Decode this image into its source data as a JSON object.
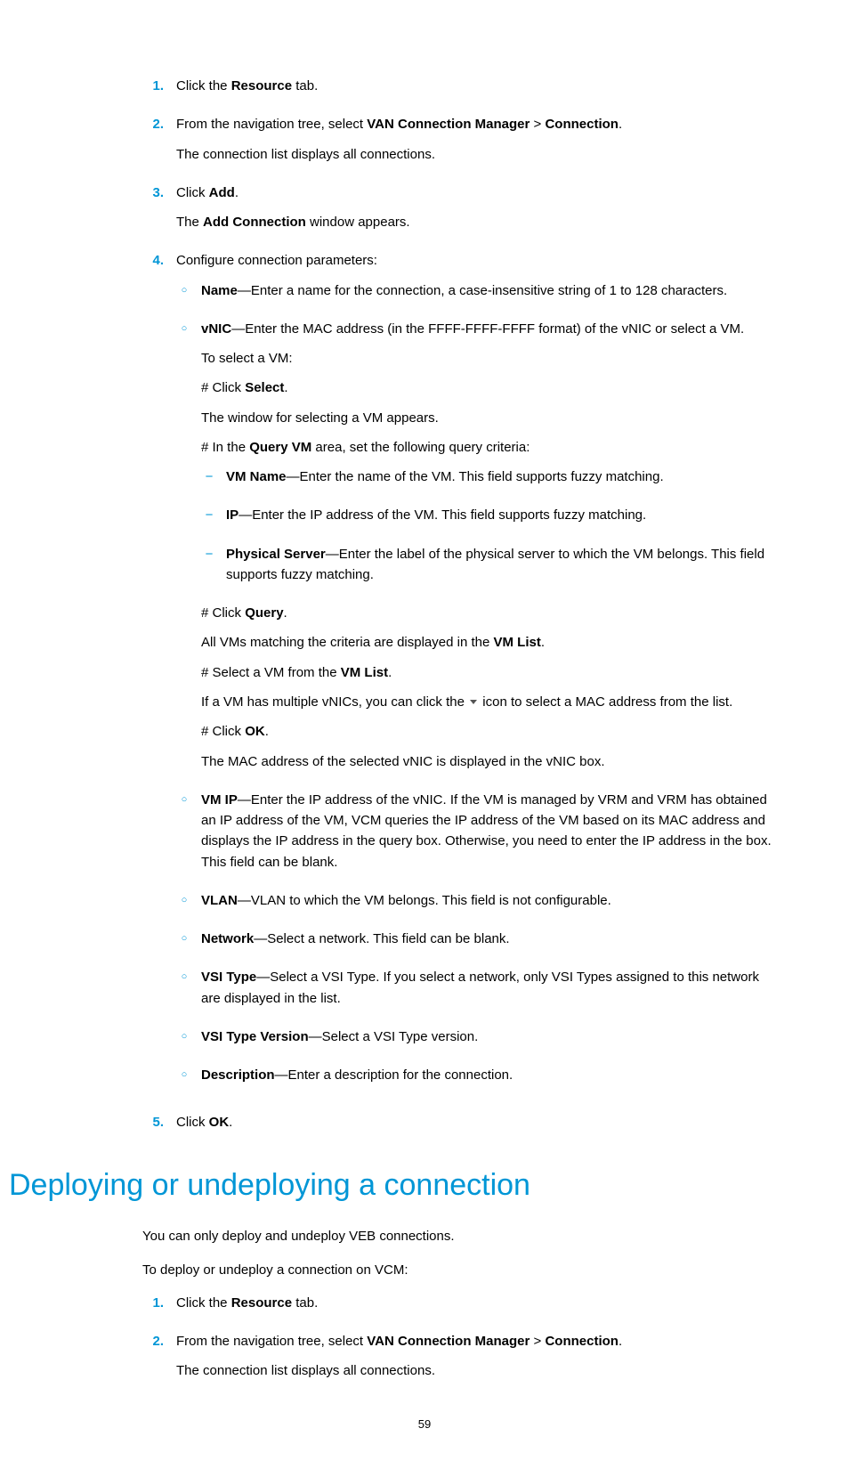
{
  "section1": {
    "steps": [
      {
        "num": "1.",
        "lines": [
          {
            "frags": [
              [
                "t",
                "Click the "
              ],
              [
                "b",
                "Resource"
              ],
              [
                "t",
                " tab."
              ]
            ]
          }
        ]
      },
      {
        "num": "2.",
        "lines": [
          {
            "frags": [
              [
                "t",
                "From the navigation tree, select "
              ],
              [
                "b",
                "VAN Connection Manager"
              ],
              [
                "t",
                " > "
              ],
              [
                "b",
                "Connection"
              ],
              [
                "t",
                "."
              ]
            ]
          },
          {
            "frags": [
              [
                "t",
                "The connection list displays all connections."
              ]
            ]
          }
        ]
      },
      {
        "num": "3.",
        "lines": [
          {
            "frags": [
              [
                "t",
                "Click "
              ],
              [
                "b",
                "Add"
              ],
              [
                "t",
                "."
              ]
            ]
          },
          {
            "frags": [
              [
                "t",
                "The "
              ],
              [
                "b",
                "Add Connection"
              ],
              [
                "t",
                " window appears."
              ]
            ]
          }
        ]
      },
      {
        "num": "4.",
        "lines": [
          {
            "frags": [
              [
                "t",
                "Configure connection parameters:"
              ]
            ]
          }
        ],
        "subs": [
          {
            "bullet": "o",
            "lines": [
              {
                "frags": [
                  [
                    "b",
                    "Name"
                  ],
                  [
                    "t",
                    "—Enter a name for the connection, a case-insensitive string of 1 to 128 characters."
                  ]
                ]
              }
            ]
          },
          {
            "bullet": "o",
            "lines": [
              {
                "frags": [
                  [
                    "b",
                    "vNIC"
                  ],
                  [
                    "t",
                    "—Enter the MAC address (in the FFFF-FFFF-FFFF format) of the vNIC or select a VM."
                  ]
                ]
              },
              {
                "frags": [
                  [
                    "t",
                    "To select a VM:"
                  ]
                ]
              },
              {
                "frags": [
                  [
                    "t",
                    "# Click "
                  ],
                  [
                    "b",
                    "Select"
                  ],
                  [
                    "t",
                    "."
                  ]
                ]
              },
              {
                "frags": [
                  [
                    "t",
                    "The window for selecting a VM appears."
                  ]
                ]
              },
              {
                "frags": [
                  [
                    "t",
                    "# In the "
                  ],
                  [
                    "b",
                    "Query VM"
                  ],
                  [
                    "t",
                    " area, set the following query criteria:"
                  ]
                ]
              }
            ],
            "dashes": [
              {
                "frags": [
                  [
                    "b",
                    "VM Name"
                  ],
                  [
                    "t",
                    "—Enter the name of the VM. This field supports fuzzy matching."
                  ]
                ]
              },
              {
                "frags": [
                  [
                    "b",
                    "IP"
                  ],
                  [
                    "t",
                    "—Enter the IP address of the VM. This field supports fuzzy matching."
                  ]
                ]
              },
              {
                "frags": [
                  [
                    "b",
                    "Physical Server"
                  ],
                  [
                    "t",
                    "—Enter the label of the physical server to which the VM belongs. This field supports fuzzy matching."
                  ]
                ]
              }
            ],
            "tail": [
              {
                "frags": [
                  [
                    "t",
                    "# Click "
                  ],
                  [
                    "b",
                    "Query"
                  ],
                  [
                    "t",
                    "."
                  ]
                ]
              },
              {
                "frags": [
                  [
                    "t",
                    "All VMs matching the criteria are displayed in the "
                  ],
                  [
                    "b",
                    "VM List"
                  ],
                  [
                    "t",
                    "."
                  ]
                ]
              },
              {
                "frags": [
                  [
                    "t",
                    "# Select a VM from the "
                  ],
                  [
                    "b",
                    "VM List"
                  ],
                  [
                    "t",
                    "."
                  ]
                ]
              },
              {
                "frags": [
                  [
                    "t",
                    "If a VM has multiple vNICs, you can click the "
                  ],
                  [
                    "icon",
                    "dropdown"
                  ],
                  [
                    "t",
                    " icon to select a MAC address from the list."
                  ]
                ]
              },
              {
                "frags": [
                  [
                    "t",
                    "# Click "
                  ],
                  [
                    "b",
                    "OK"
                  ],
                  [
                    "t",
                    "."
                  ]
                ]
              },
              {
                "frags": [
                  [
                    "t",
                    "The MAC address of the selected vNIC is displayed in the vNIC box."
                  ]
                ]
              }
            ]
          },
          {
            "bullet": "o",
            "lines": [
              {
                "frags": [
                  [
                    "b",
                    "VM IP"
                  ],
                  [
                    "t",
                    "—Enter the IP address of the vNIC. If the VM is managed by VRM and VRM has obtained an IP address of the VM, VCM queries the IP address of the VM based on its MAC address and displays the IP address in the query box. Otherwise, you need to enter the IP address in the box. This field can be blank."
                  ]
                ]
              }
            ]
          },
          {
            "bullet": "o",
            "lines": [
              {
                "frags": [
                  [
                    "b",
                    "VLAN"
                  ],
                  [
                    "t",
                    "—VLAN to which the VM belongs. This field is not configurable."
                  ]
                ]
              }
            ]
          },
          {
            "bullet": "o",
            "lines": [
              {
                "frags": [
                  [
                    "b",
                    "Network"
                  ],
                  [
                    "t",
                    "—Select a network. This field can be blank."
                  ]
                ]
              }
            ]
          },
          {
            "bullet": "o",
            "lines": [
              {
                "frags": [
                  [
                    "b",
                    "VSI Type"
                  ],
                  [
                    "t",
                    "—Select a VSI Type. If you select a network, only VSI Types assigned to this network are displayed in the list."
                  ]
                ]
              }
            ]
          },
          {
            "bullet": "o",
            "lines": [
              {
                "frags": [
                  [
                    "b",
                    "VSI Type Version"
                  ],
                  [
                    "t",
                    "—Select a VSI Type version."
                  ]
                ]
              }
            ]
          },
          {
            "bullet": "o",
            "lines": [
              {
                "frags": [
                  [
                    "b",
                    "Description"
                  ],
                  [
                    "t",
                    "—Enter a description for the connection."
                  ]
                ]
              }
            ]
          }
        ]
      },
      {
        "num": "5.",
        "lines": [
          {
            "frags": [
              [
                "t",
                "Click "
              ],
              [
                "b",
                "OK"
              ],
              [
                "t",
                "."
              ]
            ]
          }
        ]
      }
    ]
  },
  "heading2": "Deploying or undeploying a connection",
  "section2_intro": [
    {
      "frags": [
        [
          "t",
          "You can only deploy and undeploy VEB connections."
        ]
      ]
    },
    {
      "frags": [
        [
          "t",
          "To deploy or undeploy a connection on VCM:"
        ]
      ]
    }
  ],
  "section2": {
    "steps": [
      {
        "num": "1.",
        "lines": [
          {
            "frags": [
              [
                "t",
                "Click the "
              ],
              [
                "b",
                "Resource"
              ],
              [
                "t",
                " tab."
              ]
            ]
          }
        ]
      },
      {
        "num": "2.",
        "lines": [
          {
            "frags": [
              [
                "t",
                "From the navigation tree, select "
              ],
              [
                "b",
                "VAN Connection Manager"
              ],
              [
                "t",
                " > "
              ],
              [
                "b",
                "Connection"
              ],
              [
                "t",
                "."
              ]
            ]
          },
          {
            "frags": [
              [
                "t",
                "The connection list displays all connections."
              ]
            ]
          }
        ]
      }
    ]
  },
  "pageNumber": "59"
}
